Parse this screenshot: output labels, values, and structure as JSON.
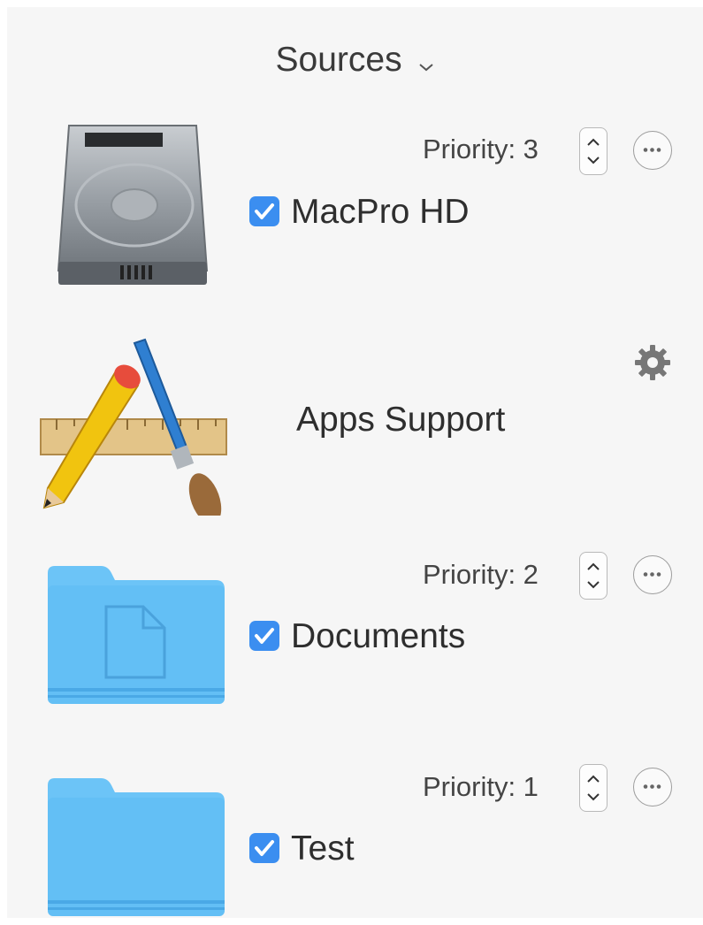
{
  "header": {
    "title": "Sources",
    "chevron_icon": "chevron-down-icon"
  },
  "sources": [
    {
      "name": "MacPro HD",
      "icon": "hard-drive-icon",
      "priority_label": "Priority: 3",
      "enabled": true,
      "actions_icon": "ellipsis-circle-icon"
    },
    {
      "name": "Apps Support",
      "icon": "xcode-app-icon",
      "settings_icon": "gear-icon"
    },
    {
      "name": "Documents",
      "icon": "documents-folder-icon",
      "priority_label": "Priority: 2",
      "enabled": true,
      "actions_icon": "ellipsis-circle-icon"
    },
    {
      "name": "Test",
      "icon": "folder-icon",
      "priority_label": "Priority: 1",
      "enabled": true,
      "actions_icon": "ellipsis-circle-icon"
    }
  ],
  "colors": {
    "accent": "#3b8ef0",
    "folder": "#6cc4f7",
    "background": "#f6f6f6"
  }
}
